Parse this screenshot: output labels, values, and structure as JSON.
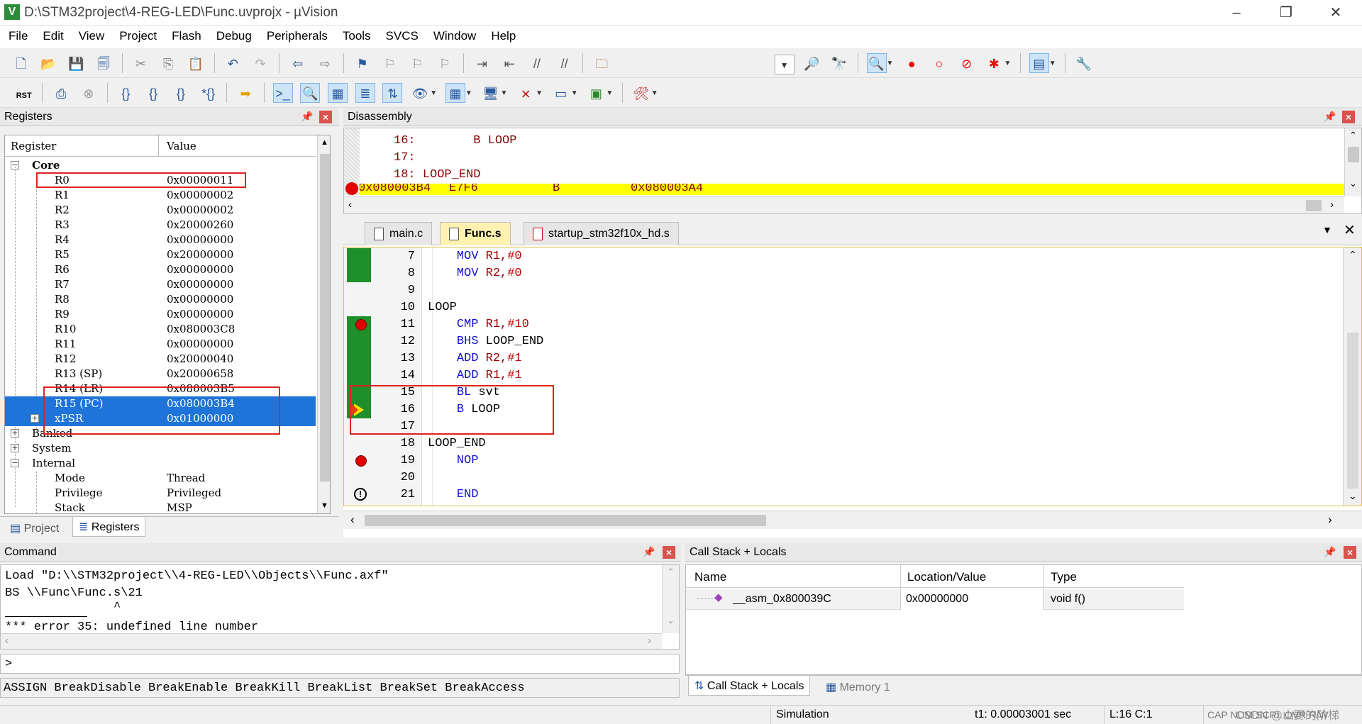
{
  "window": {
    "title": "D:\\STM32project\\4-REG-LED\\Func.uvprojx - µVision",
    "app_icon": "V"
  },
  "menu": [
    "File",
    "Edit",
    "View",
    "Project",
    "Flash",
    "Debug",
    "Peripherals",
    "Tools",
    "SVCS",
    "Window",
    "Help"
  ],
  "registers": {
    "title": "Registers",
    "col_register": "Register",
    "col_value": "Value",
    "core_label": "Core",
    "rows": [
      {
        "name": "R0",
        "value": "0x00000011"
      },
      {
        "name": "R1",
        "value": "0x00000002"
      },
      {
        "name": "R2",
        "value": "0x00000002"
      },
      {
        "name": "R3",
        "value": "0x20000260"
      },
      {
        "name": "R4",
        "value": "0x00000000"
      },
      {
        "name": "R5",
        "value": "0x20000000"
      },
      {
        "name": "R6",
        "value": "0x00000000"
      },
      {
        "name": "R7",
        "value": "0x00000000"
      },
      {
        "name": "R8",
        "value": "0x00000000"
      },
      {
        "name": "R9",
        "value": "0x00000000"
      },
      {
        "name": "R10",
        "value": "0x080003C8"
      },
      {
        "name": "R11",
        "value": "0x00000000"
      },
      {
        "name": "R12",
        "value": "0x20000040"
      },
      {
        "name": "R13 (SP)",
        "value": "0x20000658"
      },
      {
        "name": "R14 (LR)",
        "value": "0x080003B5"
      },
      {
        "name": "R15 (PC)",
        "value": "0x080003B4"
      },
      {
        "name": "xPSR",
        "value": "0x01000000"
      }
    ],
    "groups": [
      "Banked",
      "System",
      "Internal"
    ],
    "internal_rows": [
      {
        "name": "Mode",
        "value": "Thread"
      },
      {
        "name": "Privilege",
        "value": "Privileged"
      },
      {
        "name": "Stack",
        "value": "MSP"
      }
    ],
    "tab_project": "Project",
    "tab_registers": "Registers"
  },
  "disassembly": {
    "title": "Disassembly",
    "lines": [
      {
        "num": "16:",
        "code": "        B LOOP"
      },
      {
        "num": "17:",
        "code": ""
      },
      {
        "num": "18:",
        "code": "LOOP_END"
      }
    ],
    "current": {
      "addr": "0x080003B4",
      "opcode": "E7F6",
      "instr": "B",
      "operand": "0x080003A4"
    }
  },
  "editor": {
    "tabs": [
      "main.c",
      "Func.s",
      "startup_stm32f10x_hd.s"
    ],
    "active_tab": "Func.s",
    "lines": [
      {
        "n": "7",
        "indent": "    ",
        "op": "MOV",
        "args": "R1,#0"
      },
      {
        "n": "8",
        "indent": "    ",
        "op": "MOV",
        "args": "R2,#0"
      },
      {
        "n": "9",
        "indent": "",
        "op": "",
        "args": ""
      },
      {
        "n": "10",
        "indent": "",
        "op": "",
        "args": "LOOP"
      },
      {
        "n": "11",
        "indent": "    ",
        "op": "CMP",
        "args": "R1,#10"
      },
      {
        "n": "12",
        "indent": "    ",
        "op": "BHS",
        "args": "LOOP_END"
      },
      {
        "n": "13",
        "indent": "    ",
        "op": "ADD",
        "args": "R2,#1"
      },
      {
        "n": "14",
        "indent": "    ",
        "op": "ADD",
        "args": "R1,#1"
      },
      {
        "n": "15",
        "indent": "    ",
        "op": "BL",
        "args": "svt"
      },
      {
        "n": "16",
        "indent": "    ",
        "op": "B",
        "args": "LOOP"
      },
      {
        "n": "17",
        "indent": "",
        "op": "",
        "args": ""
      },
      {
        "n": "18",
        "indent": "",
        "op": "",
        "args": "LOOP_END"
      },
      {
        "n": "19",
        "indent": "    ",
        "op": "NOP",
        "args": ""
      },
      {
        "n": "20",
        "indent": "",
        "op": "",
        "args": ""
      },
      {
        "n": "21",
        "indent": "    ",
        "op": "END",
        "args": ""
      }
    ]
  },
  "command": {
    "title": "Command",
    "output": [
      "Load \"D:\\\\STM32project\\\\4-REG-LED\\\\Objects\\\\Func.axf\"",
      "BS \\\\Func\\Func.s\\21",
      "               ^",
      "*** error 35: undefined line number"
    ],
    "prompt": ">",
    "hints": "ASSIGN BreakDisable BreakEnable BreakKill BreakList BreakSet BreakAccess"
  },
  "callstack": {
    "title": "Call Stack + Locals",
    "columns": [
      "Name",
      "Location/Value",
      "Type"
    ],
    "rows": [
      {
        "name": "__asm_0x800039C",
        "value": "0x00000000",
        "type": "void f()"
      }
    ],
    "tab_callstack": "Call Stack + Locals",
    "tab_memory": "Memory 1"
  },
  "status": {
    "mode": "Simulation",
    "time": "t1: 0.00003001 sec",
    "position": "L:16 C:1",
    "flags": "CAP  NUM  SCRL  OVR  R/W",
    "watermark": "CSDN @山野的阶梯"
  },
  "colors": {
    "selection": "#1e74d8",
    "highlight_line": "#ffff00",
    "keyword": "#1010d0",
    "register": "#a00000",
    "annotation_box": "#e02020",
    "coverage_green": "#1e8f2a"
  }
}
